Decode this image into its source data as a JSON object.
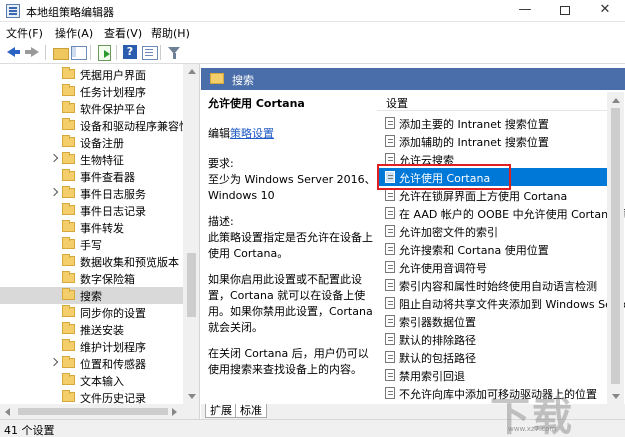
{
  "window": {
    "title": "本地组策略编辑器",
    "minimize": "—",
    "close": "✕"
  },
  "menu": [
    "文件(F)",
    "操作(A)",
    "查看(V)",
    "帮助(H)"
  ],
  "tree": {
    "items": [
      {
        "label": "凭据用户界面",
        "expandable": false
      },
      {
        "label": "任务计划程序",
        "expandable": false
      },
      {
        "label": "软件保护平台",
        "expandable": false
      },
      {
        "label": "设备和驱动程序兼容性",
        "expandable": false
      },
      {
        "label": "设备注册",
        "expandable": false
      },
      {
        "label": "生物特征",
        "expandable": true
      },
      {
        "label": "事件查看器",
        "expandable": false
      },
      {
        "label": "事件日志服务",
        "expandable": true
      },
      {
        "label": "事件日志记录",
        "expandable": false
      },
      {
        "label": "事件转发",
        "expandable": false
      },
      {
        "label": "手写",
        "expandable": false
      },
      {
        "label": "数据收集和预览版本",
        "expandable": false
      },
      {
        "label": "数字保险箱",
        "expandable": false
      },
      {
        "label": "搜索",
        "expandable": false,
        "selected": true
      },
      {
        "label": "同步你的设置",
        "expandable": false
      },
      {
        "label": "推送安装",
        "expandable": false
      },
      {
        "label": "维护计划程序",
        "expandable": false
      },
      {
        "label": "位置和传感器",
        "expandable": true
      },
      {
        "label": "文本输入",
        "expandable": false
      },
      {
        "label": "文件历史记录",
        "expandable": false
      }
    ]
  },
  "details": {
    "header": "搜索",
    "heading": "允许使用 Cortana",
    "edit_prefix": "编辑",
    "edit_link": "策略设置",
    "req_label": "要求:",
    "req_text": "至少为 Windows Server 2016、Windows 10",
    "desc_label": "描述:",
    "desc_text": "此策略设置指定是否允许在设备上使用 Cortana。",
    "desc_text2": "如果你启用此设置或不配置此设置，Cortana 就可以在设备上使用。如果你禁用此设置，Cortana 就会关闭。",
    "desc_text3": "在关闭 Cortana 后，用户仍可以使用搜索来查找设备上的内容。"
  },
  "settings": {
    "column_header": "设置",
    "items": [
      "添加主要的 Intranet 搜索位置",
      "添加辅助的 Intranet 搜索位置",
      "允许云搜索",
      "允许使用 Cortana",
      "允许在锁屏界面上方使用 Cortana",
      "在 AAD 帐户的 OOBE 中允许使用 Cortana 页面",
      "允许加密文件的索引",
      "允许搜索和 Cortana 使用位置",
      "允许使用音调符号",
      "索引内容和属性时始终使用自动语言检测",
      "阻止自动将共享文件夹添加到 Windows Search",
      "索引器数据位置",
      "默认的排除路径",
      "默认的包括路径",
      "禁用索引回退",
      "不允许向库中添加可移动驱动器上的位置"
    ],
    "selected_index": 3
  },
  "tabs": [
    "扩展",
    "标准"
  ],
  "status": {
    "text": "41 个设置"
  },
  "watermark": {
    "url": "www.xz7.com"
  }
}
